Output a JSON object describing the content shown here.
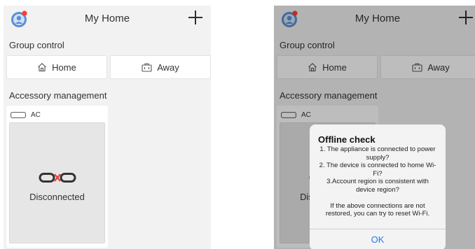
{
  "header": {
    "title": "My Home"
  },
  "group_control": {
    "label": "Group control",
    "buttons": [
      {
        "label": "Home",
        "icon": "home-icon"
      },
      {
        "label": "Away",
        "icon": "suitcase-icon"
      }
    ]
  },
  "accessory_management": {
    "label": "Accessory management",
    "devices": [
      {
        "name": "AC",
        "icon": "ac-unit-icon",
        "status": "Disconnected",
        "status_icon": "disconnected-icon"
      }
    ]
  },
  "dialog": {
    "title": "Offline check",
    "items": [
      "1. The appliance is connected to power supply?",
      "2. The device is connected to home Wi-Fi?",
      "3.Account region is consistent with device region?"
    ],
    "note": "If the above connections are not restored, you can try to reset Wi-Fi.",
    "ok_label": "OK"
  },
  "colors": {
    "accent": "#1a7cf5",
    "background": "#f2f2f2",
    "card": "#ffffff",
    "disconnected_panel": "#e6e6e6",
    "avatar_dot": "#ff3b30"
  }
}
